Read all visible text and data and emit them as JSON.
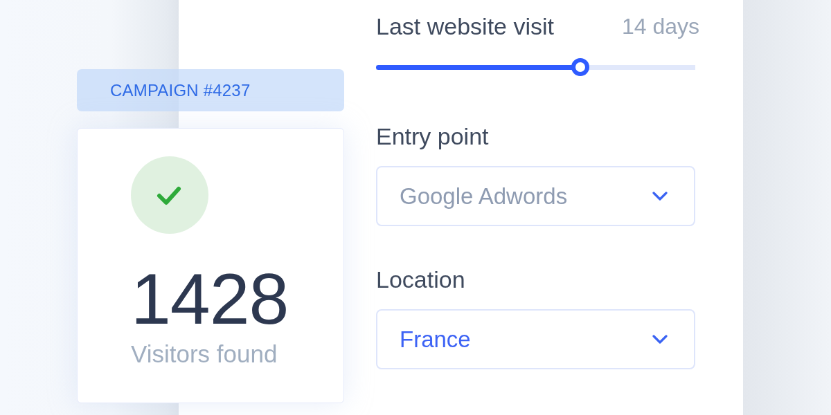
{
  "campaign": {
    "label": "CAMPAIGN #4237"
  },
  "result": {
    "success": true,
    "count": "1428",
    "caption": "Visitors found"
  },
  "filters": [
    {
      "kind": "slider",
      "label": "Last website visit",
      "reading": "14 days",
      "level": 0.64
    },
    {
      "kind": "select",
      "label": "Entry point",
      "placeholder": "Google Adwords"
    },
    {
      "kind": "select",
      "label": "Location",
      "value": "France"
    }
  ]
}
